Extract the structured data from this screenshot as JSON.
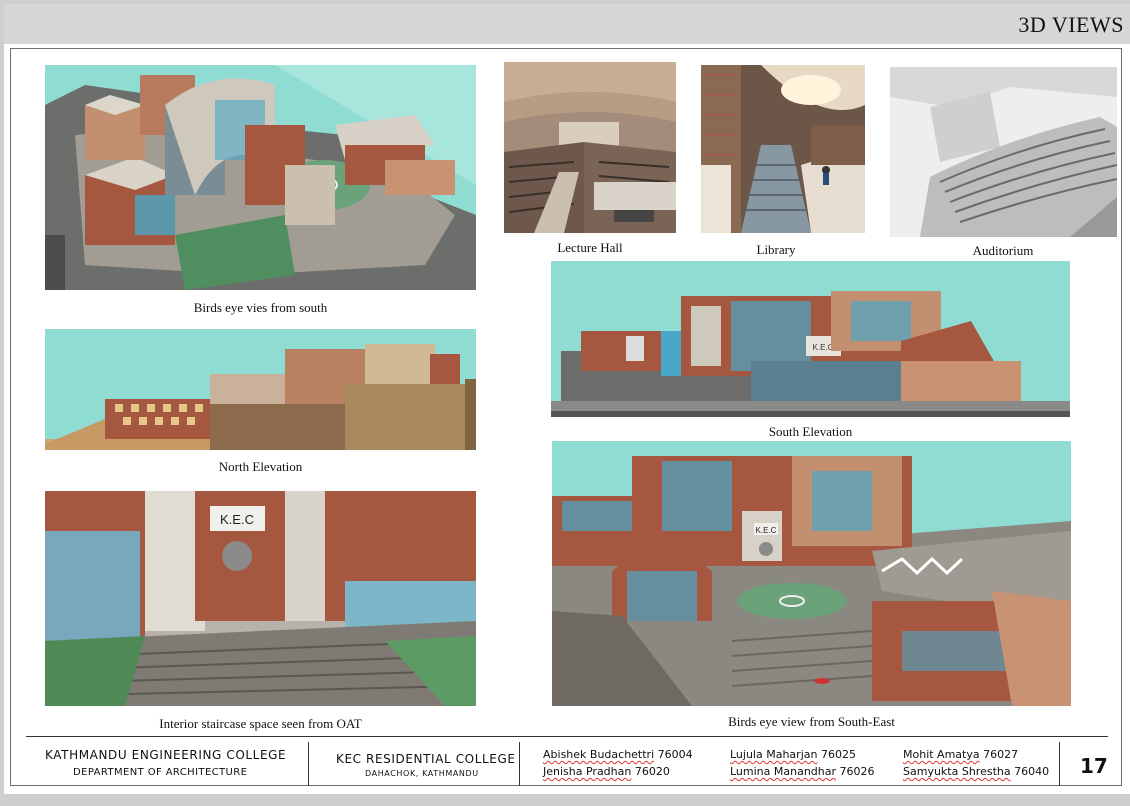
{
  "header": {
    "title": "3D VIEWS"
  },
  "captions": {
    "birds_eye_south": "Birds eye vies from south",
    "lecture_hall": "Lecture Hall",
    "library": "Library",
    "auditorium": "Auditorium",
    "north_elevation": "North Elevation",
    "south_elevation": "South Elevation",
    "interior_staircase": "Interior staircase space seen from OAT",
    "birds_eye_southeast": "Birds eye view from South-East"
  },
  "renders": {
    "kec_sign_oat": "K.E.C",
    "kec_sign_south_elevation": "K.E.C",
    "kec_sign_southeast": "K.E.C"
  },
  "footer": {
    "college": "KATHMANDU ENGINEERING COLLEGE",
    "department": "DEPARTMENT OF ARCHITECTURE",
    "project": "KEC RESIDENTIAL COLLEGE",
    "location": "DAHACHOK, KATHMANDU",
    "members": [
      {
        "name": "Abishek Budachettri",
        "id": "76004"
      },
      {
        "name": "Jenisha Pradhan",
        "id": "76020"
      },
      {
        "name": "Lujula Maharjan",
        "id": "76025"
      },
      {
        "name": "Lumina Manandhar",
        "id": "76026"
      },
      {
        "name": "Mohit Amatya",
        "id": "76027"
      },
      {
        "name": "Samyukta Shrestha",
        "id": "76040"
      }
    ],
    "page_number": "17"
  },
  "colors": {
    "sky": "#8fdcd2",
    "brick": "#a5583f",
    "concrete": "#bdb7ae",
    "glass": "#4aa7c7",
    "grass": "#5a9a66"
  }
}
